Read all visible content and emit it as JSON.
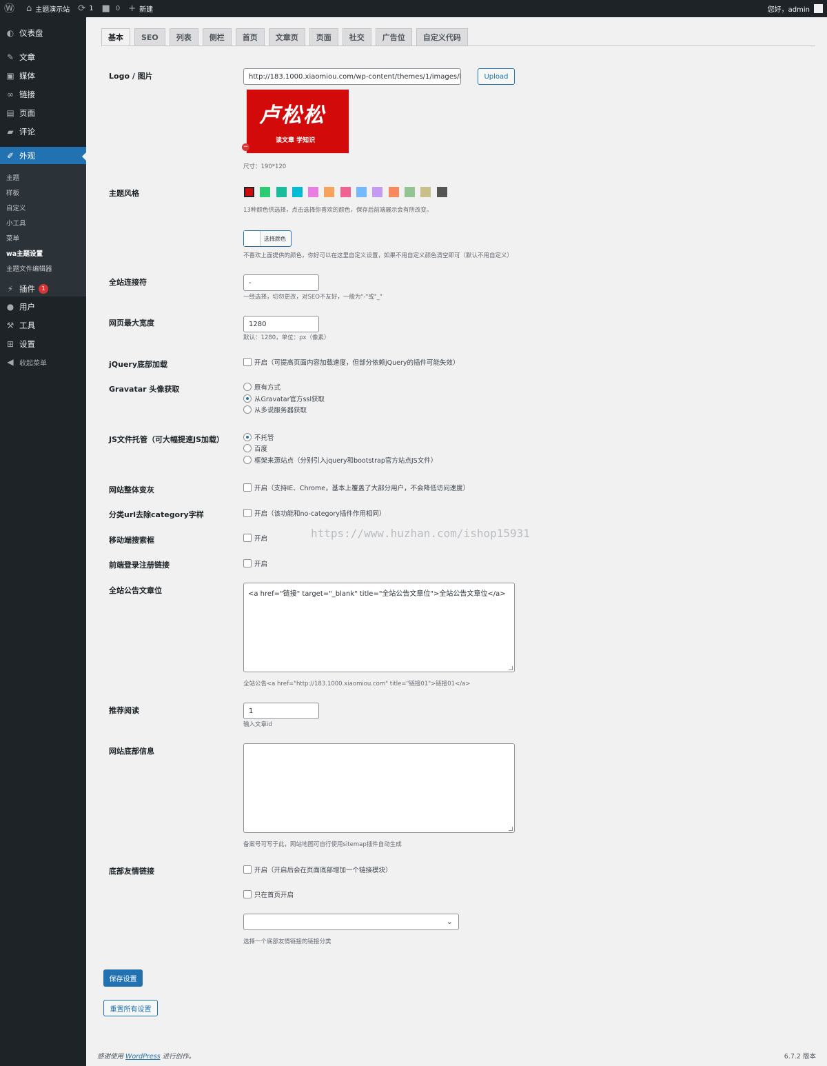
{
  "adminbar": {
    "site_name": "主题演示站",
    "updates_count": "1",
    "comments_count": "0",
    "new_label": "新建",
    "greeting": "您好，admin"
  },
  "sidebar": {
    "items": [
      {
        "label": "仪表盘",
        "icon": "dashboard-icon"
      },
      {
        "label": "文章",
        "icon": "pin-icon"
      },
      {
        "label": "媒体",
        "icon": "media-icon"
      },
      {
        "label": "链接",
        "icon": "link-icon"
      },
      {
        "label": "页面",
        "icon": "page-icon"
      },
      {
        "label": "评论",
        "icon": "comment-icon"
      },
      {
        "label": "外观",
        "icon": "brush-icon"
      }
    ],
    "submenu": [
      "主题",
      "样板",
      "自定义",
      "小工具",
      "菜单",
      "wa主题设置",
      "主题文件编辑器"
    ],
    "items_after": [
      {
        "label": "插件",
        "icon": "plugin-icon",
        "badge": "1"
      },
      {
        "label": "用户",
        "icon": "user-icon"
      },
      {
        "label": "工具",
        "icon": "wrench-icon"
      },
      {
        "label": "设置",
        "icon": "settings-icon"
      }
    ],
    "collapse_label": "收起菜单"
  },
  "tabs": [
    "基本",
    "SEO",
    "列表",
    "侧栏",
    "首页",
    "文章页",
    "页面",
    "社交",
    "广告位",
    "自定义代码"
  ],
  "fields": {
    "logo": {
      "label": "Logo / 图片",
      "value": "http://183.1000.xiaomiou.com/wp-content/themes/1/images/l",
      "upload": "Upload",
      "image_brand": "卢松松",
      "image_slogan": "读文章  学知识",
      "size_hint": "尺寸：190*120"
    },
    "theme_style": {
      "label": "主题风格",
      "colors": [
        "#d20a0a",
        "#2ecc71",
        "#1abc9c",
        "#00bcd4",
        "#e97de0",
        "#f7a35c",
        "#f06292",
        "#74b9ff",
        "#c39bf0",
        "#f7895f",
        "#93c594",
        "#c8c088",
        "#555555"
      ],
      "hint": "13种颜色供选择，点击选择你喜欢的颜色，保存后前端展示会有所改变。",
      "picker_label": "选择颜色",
      "picker_hint": "不喜欢上面提供的颜色，你好可以在这里自定义设置，如果不用自定义颜色清空即可（默认不用自定义）"
    },
    "separator": {
      "label": "全站连接符",
      "value": "-",
      "hint": "一经选择，切勿更改，对SEO不友好，一般为\"-\"或\"_\""
    },
    "max_width": {
      "label": "网页最大宽度",
      "value": "1280",
      "hint": "默认：1280，单位：px（像素）"
    },
    "jquery": {
      "label": "jQuery底部加载",
      "option": "开启（可提高页面内容加载速度，但部分依赖jQuery的插件可能失效）"
    },
    "gravatar": {
      "label": "Gravatar 头像获取",
      "options": [
        "原有方式",
        "从Gravatar官方ssl获取",
        "从多说服务器获取"
      ],
      "selected": 1
    },
    "js_host": {
      "label": "JS文件托管（可大幅提速JS加载）",
      "options": [
        "不托管",
        "百度",
        "框架来源站点（分别引入jquery和bootstrap官方站点JS文件）"
      ],
      "selected": 0
    },
    "grayscale": {
      "label": "网站整体变灰",
      "option": "开启（支持IE、Chrome，基本上覆盖了大部分用户，不会降低访问速度）"
    },
    "category_url": {
      "label": "分类url去除category字样",
      "option": "开启（该功能和no-category插件作用相同）"
    },
    "mobile_search": {
      "label": "移动端搜索框",
      "option": "开启"
    },
    "login_link": {
      "label": "前端登录注册链接",
      "option": "开启"
    },
    "notice": {
      "label": "全站公告文章位",
      "value": "<a href=\"链接\" target=\"_blank\" title=\"全站公告文章位\">全站公告文章位</a>",
      "hint": "全站公告<a href=\"http://183.1000.xiaomiou.com\" title=\"链接01\">链接01</a>"
    },
    "recommend": {
      "label": "推荐阅读",
      "value": "1",
      "hint": "输入文章id"
    },
    "footer_info": {
      "label": "网站底部信息",
      "value": "",
      "hint": "备案号可写于此，网站地图可自行使用sitemap插件自动生成"
    },
    "friend_links": {
      "label": "底部友情链接",
      "option1": "开启（开启后会在页面底部增加一个链接模块）",
      "option2": "只在首页开启",
      "select_value": "",
      "hint": "选择一个底部友情链接的链接分类"
    }
  },
  "buttons": {
    "save": "保存设置",
    "reset": "重置所有设置"
  },
  "watermark": "https://www.huzhan.com/ishop15931",
  "footer": {
    "thanks_prefix": "感谢使用",
    "wordpress": "WordPress",
    "thanks_suffix": "进行创作。",
    "version": "6.7.2 版本"
  }
}
